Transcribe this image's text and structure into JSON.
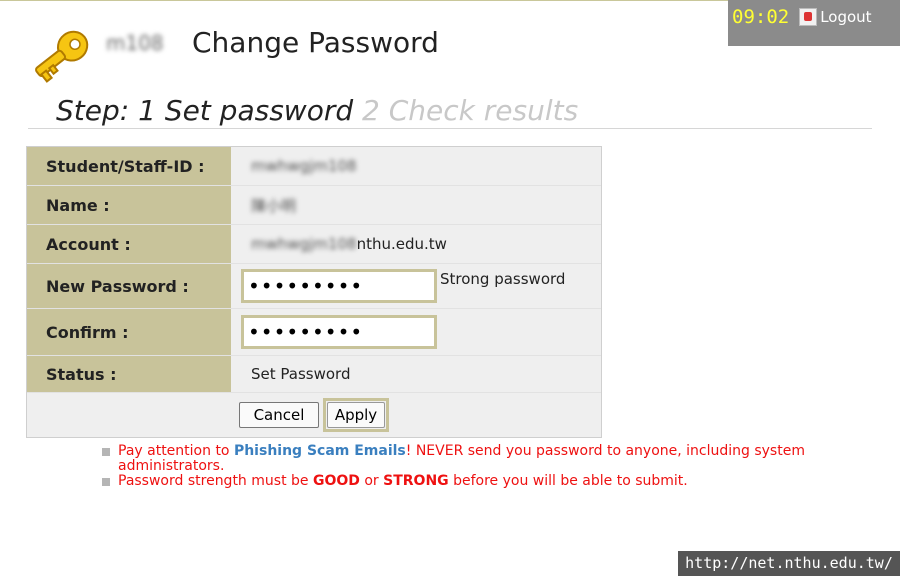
{
  "topbar": {
    "clock": "09:02",
    "logout_label": "Logout"
  },
  "header": {
    "username_blurred": "m108",
    "title": "Change Password",
    "step_current": "Step: 1 Set password",
    "step_next": "2 Check results"
  },
  "form": {
    "fields": [
      {
        "label": "Student/Staff-ID :",
        "value": "mwhwgjm108"
      },
      {
        "label": "Name :",
        "value": "陳小明"
      },
      {
        "label": "Account :",
        "value_blurred": "mwhwgjm108",
        "value_suffix": "nthu.edu.tw"
      },
      {
        "label": "New Password :",
        "value": "•••••••••",
        "strength": "Strong password"
      },
      {
        "label": "Confirm :",
        "value": "•••••••••"
      },
      {
        "label": "Status :",
        "value": "Set Password"
      }
    ],
    "cancel_label": "Cancel",
    "apply_label": "Apply"
  },
  "notes": {
    "n1_pre": "Pay attention to ",
    "n1_link": "Phishing Scam Emails",
    "n1_post": "! NEVER send you password to anyone, including system administrators.",
    "n2_pre": "Password strength must be ",
    "n2_good": "GOOD",
    "n2_mid": " or ",
    "n2_strong": "STRONG",
    "n2_post": " before you will be able to submit."
  },
  "footer": {
    "url": "http://net.nthu.edu.tw/"
  },
  "colors": {
    "accent_tan": "#c8c39a",
    "warning_red": "#ee1111",
    "link_blue": "#3a7fbf",
    "clock_yellow": "#ffff33"
  }
}
